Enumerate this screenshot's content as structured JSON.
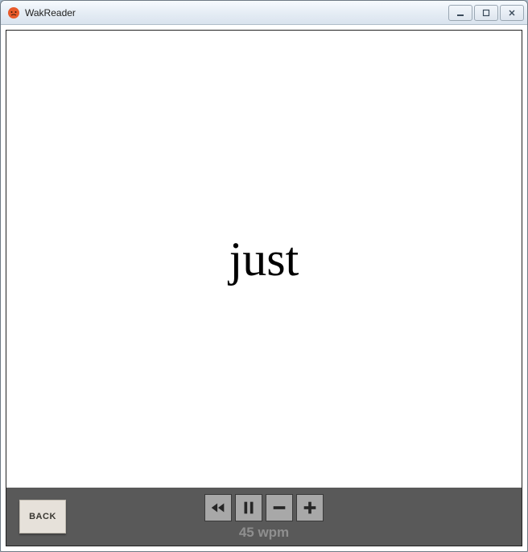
{
  "window": {
    "title": "WakReader"
  },
  "reader": {
    "current_word": "just"
  },
  "controls": {
    "back_label": "BACK",
    "wpm_text": "45 wpm"
  },
  "icons": {
    "app": "app-icon",
    "minimize": "minimize-icon",
    "maximize": "maximize-icon",
    "close": "close-icon",
    "rewind": "rewind-icon",
    "pause": "pause-icon",
    "minus": "minus-icon",
    "plus": "plus-icon"
  }
}
